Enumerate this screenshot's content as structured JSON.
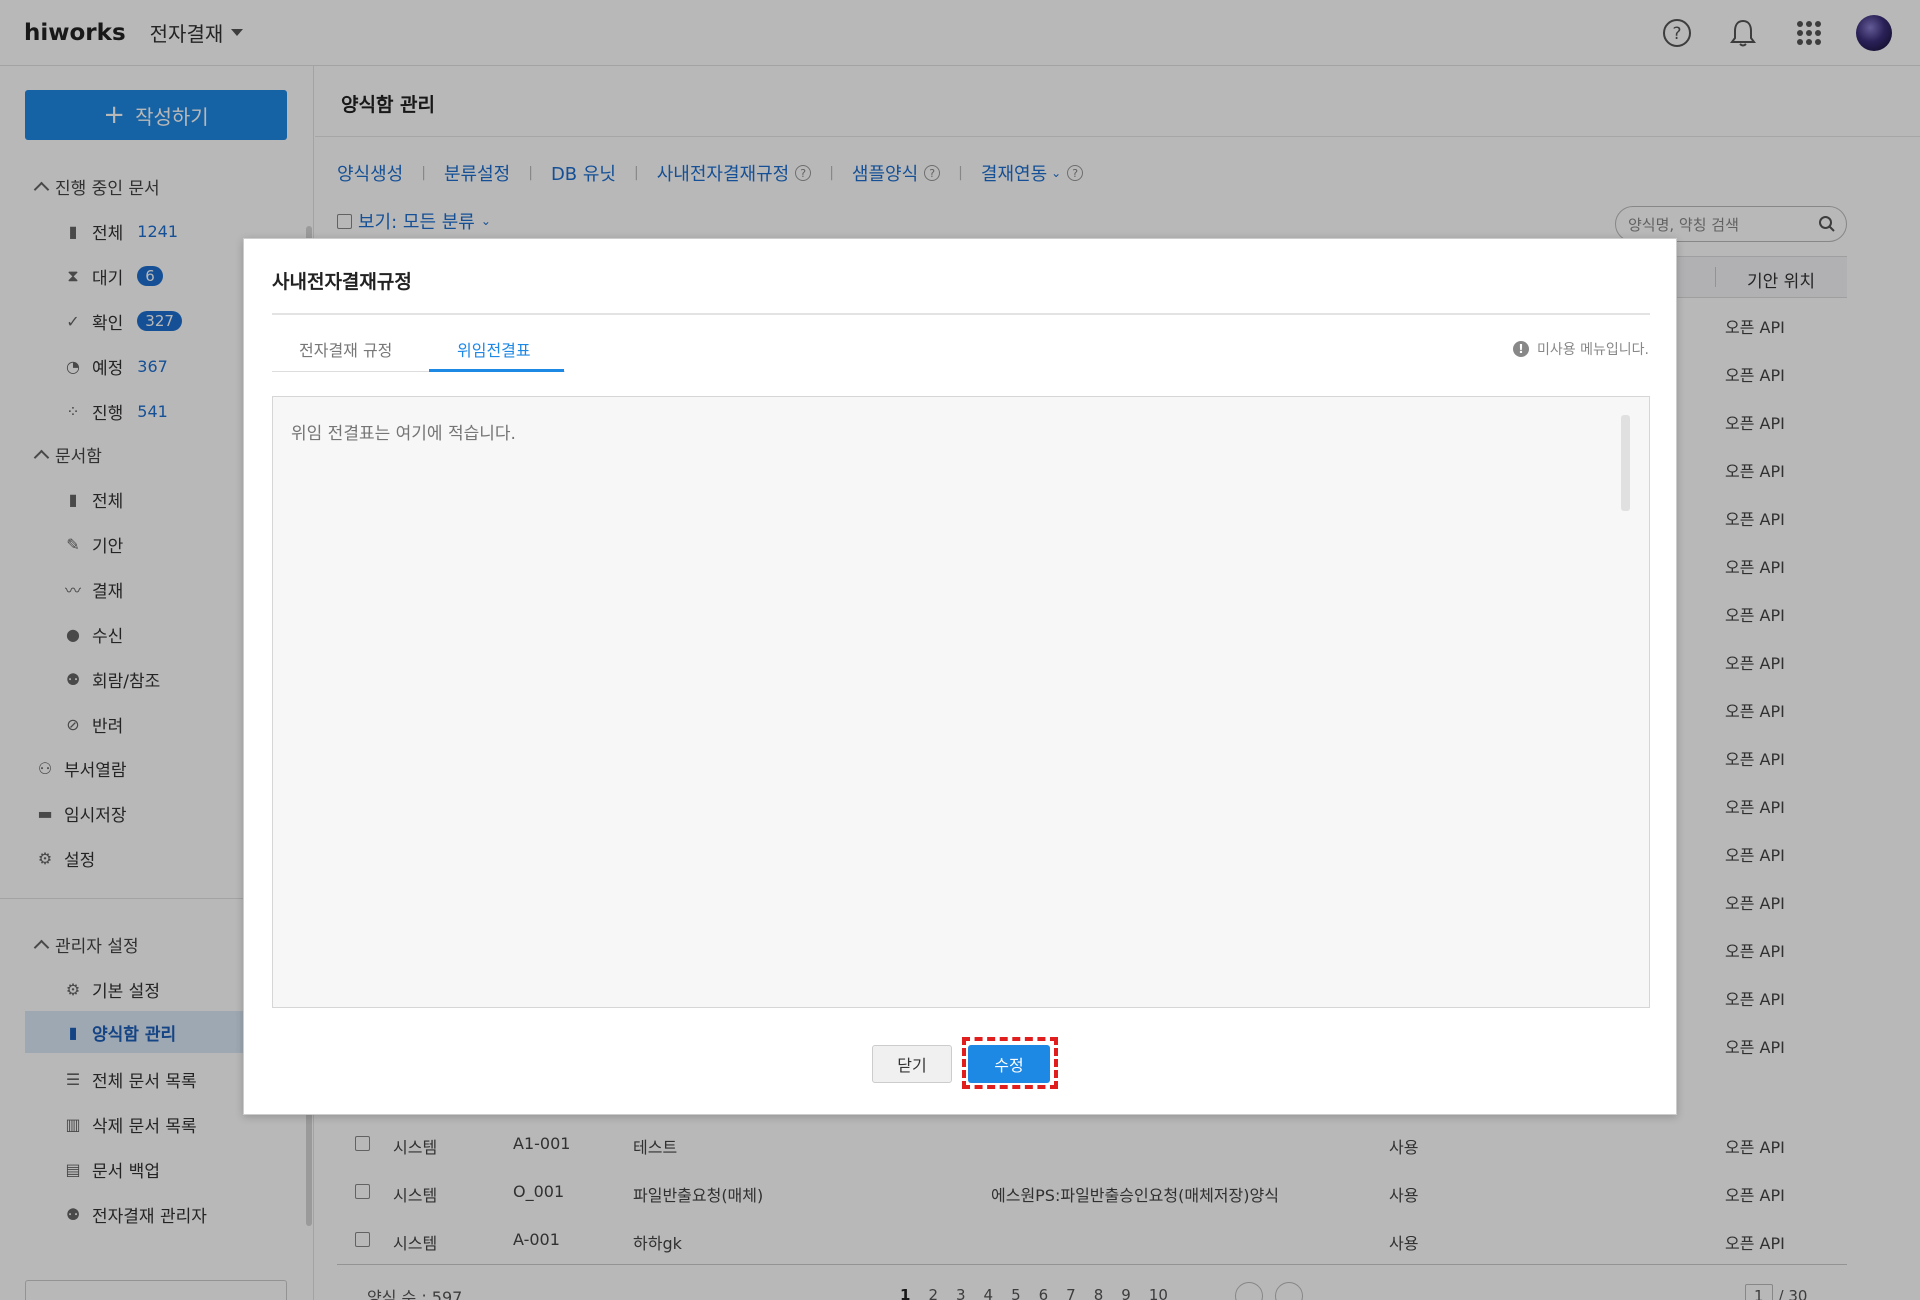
{
  "header": {
    "logo": "hiworks",
    "app_name": "전자결재"
  },
  "sidebar": {
    "compose_label": "작성하기",
    "sections": {
      "in_progress": "진행 중인 문서",
      "docbox": "문서함",
      "admin": "관리자 설정"
    },
    "in_progress_items": [
      {
        "label": "전체",
        "count": "1241"
      },
      {
        "label": "대기",
        "count": "6"
      },
      {
        "label": "확인",
        "count": "327"
      },
      {
        "label": "예정",
        "count": "367"
      },
      {
        "label": "진행",
        "count": "541"
      }
    ],
    "docbox_items": [
      {
        "label": "전체"
      },
      {
        "label": "기안"
      },
      {
        "label": "결재"
      },
      {
        "label": "수신"
      },
      {
        "label": "회람/참조"
      },
      {
        "label": "반려"
      }
    ],
    "top_items": [
      {
        "label": "부서열람"
      },
      {
        "label": "임시저장"
      },
      {
        "label": "설정"
      }
    ],
    "admin_items": [
      {
        "label": "기본 설정"
      },
      {
        "label": "양식함 관리"
      },
      {
        "label": "전체 문서 목록"
      },
      {
        "label": "삭제 문서 목록"
      },
      {
        "label": "문서 백업"
      },
      {
        "label": "전자결재 관리자"
      }
    ]
  },
  "main": {
    "title": "양식함 관리",
    "tabs": [
      {
        "label": "양식생성"
      },
      {
        "label": "분류설정"
      },
      {
        "label": "DB 유닛"
      },
      {
        "label": "사내전자결재규정"
      },
      {
        "label": "샘플양식"
      },
      {
        "label": "결재연동"
      }
    ],
    "view_filter": "보기: 모든 분류",
    "search_placeholder": "양식명, 약칭 검색",
    "column_position": "기안 위치",
    "api_values": [
      "오픈 API",
      "오픈 API",
      "오픈 API",
      "오픈 API",
      "오픈 API",
      "오픈 API",
      "오픈 API",
      "오픈 API",
      "오픈 API",
      "오픈 API",
      "오픈 API",
      "오픈 API",
      "오픈 API",
      "오픈 API",
      "오픈 API",
      "오픈 API"
    ],
    "rows": [
      {
        "type": "시스템",
        "code": "A1-001",
        "name": "테스트",
        "desc": "",
        "use": "사용",
        "position": "오픈 API"
      },
      {
        "type": "시스템",
        "code": "O_001",
        "name": "파일반출요청(매체)",
        "desc": "에스원PS:파일반출승인요청(매체저장)양식",
        "use": "사용",
        "position": "오픈 API"
      },
      {
        "type": "시스템",
        "code": "A-001",
        "name": "하하gk",
        "desc": "",
        "use": "사용",
        "position": "오픈 API"
      }
    ],
    "footer_count": "양식 수 : 597",
    "pages": [
      "1",
      "2",
      "3",
      "4",
      "5",
      "6",
      "7",
      "8",
      "9",
      "10"
    ],
    "page_select": "1",
    "page_total": "/ 30"
  },
  "modal": {
    "title": "사내전자결재규정",
    "tabs": [
      "전자결재 규정",
      "위임전결표"
    ],
    "active_tab": "위임전결표",
    "notice": "미사용 메뉴입니다.",
    "textarea_placeholder": "위임 전결표는 여기에 적습니다.",
    "close_label": "닫기",
    "edit_label": "수정"
  },
  "colors": {
    "accent": "#1e88e5",
    "highlight_frame": "#e01e1e"
  }
}
